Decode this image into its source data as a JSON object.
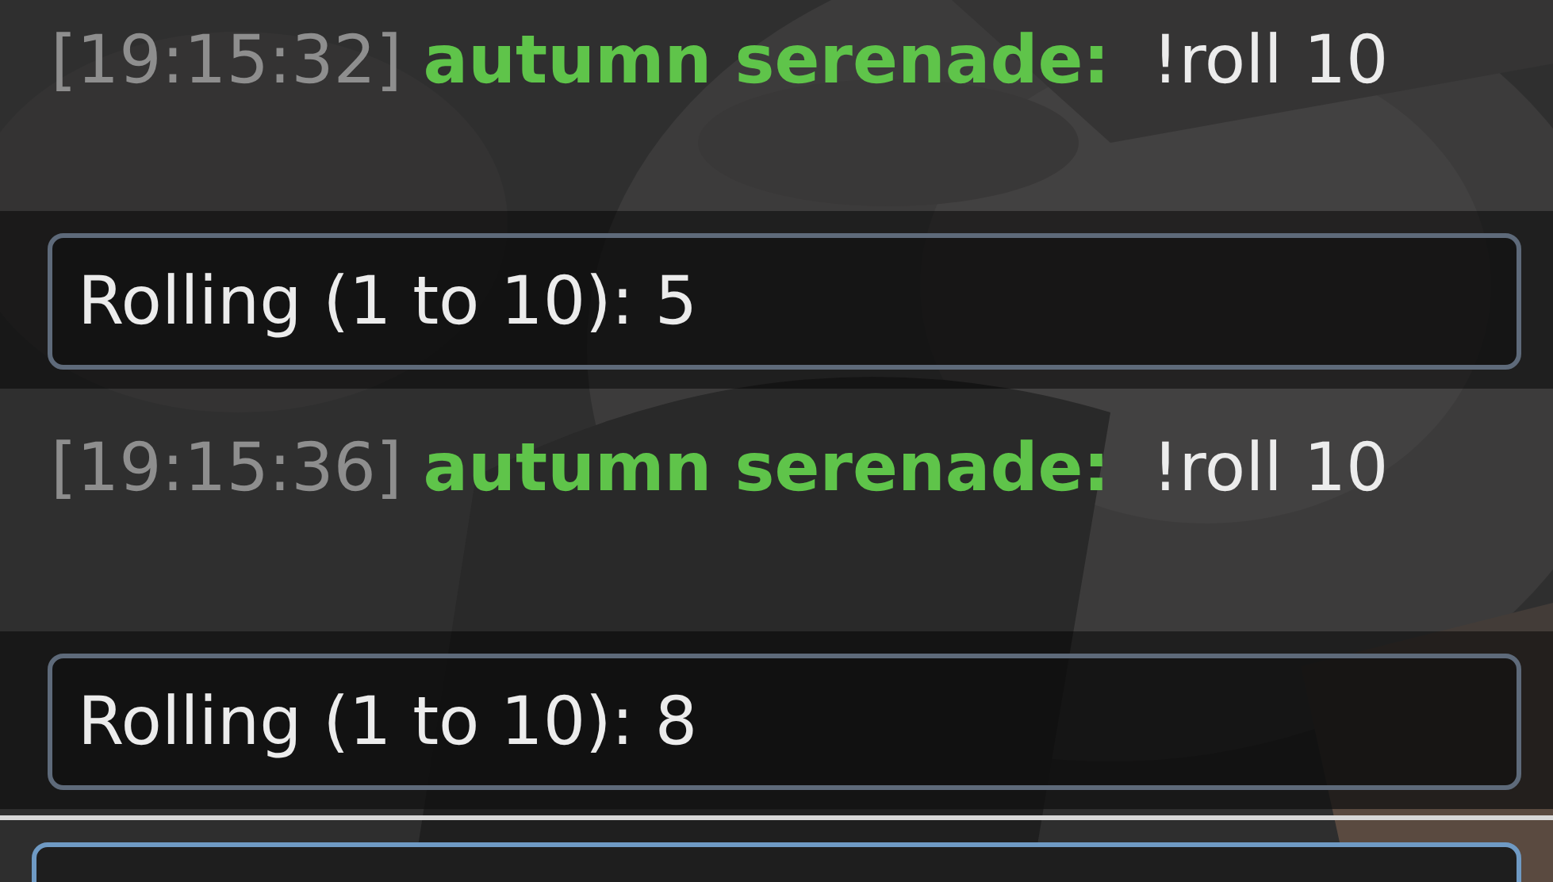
{
  "messages": [
    {
      "kind": "chat",
      "timestamp": "[19:15:32]",
      "author": "autumn serenade:",
      "text": "!roll 10"
    },
    {
      "kind": "bot",
      "text": "Rolling (1 to 10): 5"
    },
    {
      "kind": "chat",
      "timestamp": "[19:15:36]",
      "author": "autumn serenade:",
      "text": "!roll 10"
    },
    {
      "kind": "bot",
      "text": "Rolling (1 to 10): 8"
    }
  ]
}
